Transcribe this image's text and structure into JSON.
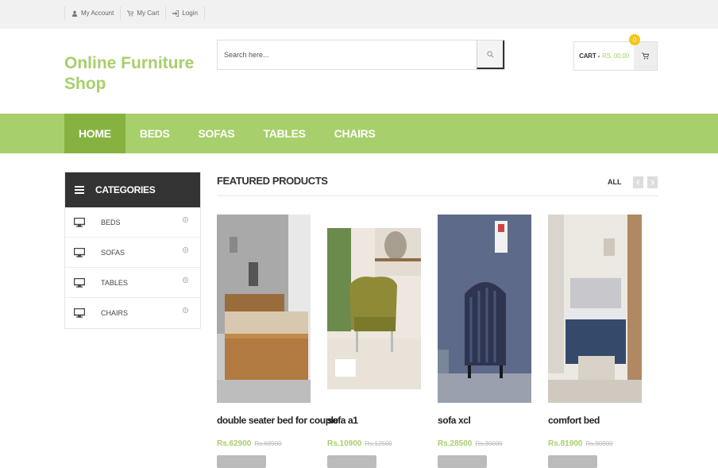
{
  "topbar": {
    "links": [
      {
        "label": "My Account",
        "icon": "user-icon"
      },
      {
        "label": "My Cart",
        "icon": "cart-icon"
      },
      {
        "label": "Login",
        "icon": "login-icon"
      }
    ]
  },
  "brand": {
    "title": "Online Furniture Shop"
  },
  "search": {
    "placeholder": "Search here..."
  },
  "cart": {
    "label": "CART -",
    "amount": "RS. 00.00",
    "count": "0"
  },
  "nav": {
    "items": [
      "HOME",
      "BEDS",
      "SOFAS",
      "TABLES",
      "CHAIRS"
    ],
    "active": "HOME"
  },
  "categories": {
    "title": "CATEGORIES",
    "items": [
      "BEDS",
      "SOFAS",
      "TABLES",
      "CHAIRS"
    ]
  },
  "featured": {
    "title": "FEATURED PRODUCTS",
    "all_label": "ALL",
    "products": [
      {
        "name": "double seater bed for couple",
        "price": "Rs.62900",
        "old_price": "Rs.68900"
      },
      {
        "name": "sofa a1",
        "price": "Rs.10900",
        "old_price": "Rs.12500"
      },
      {
        "name": "sofa xcl",
        "price": "Rs.28500",
        "old_price": "Rs.30000"
      },
      {
        "name": "comfort bed",
        "price": "Rs.81900",
        "old_price": "Rs.90900"
      }
    ]
  },
  "colors": {
    "accent": "#a7cf6b",
    "accent_dark": "#86b33f",
    "dark": "#333333",
    "badge": "#f5c518"
  }
}
